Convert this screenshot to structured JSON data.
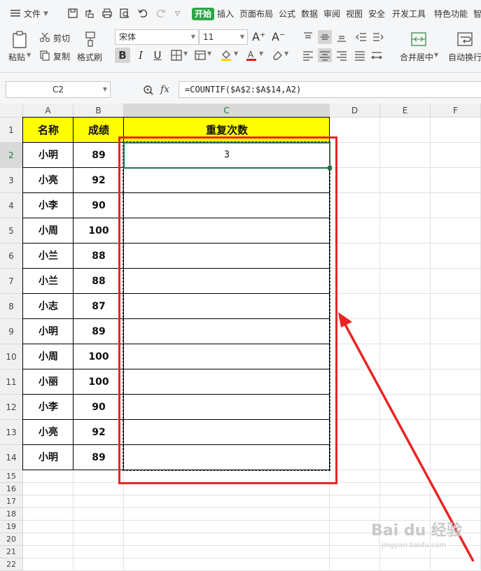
{
  "menubar": {
    "items": [
      "文件",
      "开始",
      "插入",
      "页面布局",
      "公式",
      "数据",
      "审阅",
      "视图",
      "安全",
      "开发工具",
      "特色功能",
      "智"
    ],
    "active_index": 1
  },
  "ribbon": {
    "paste_label": "粘贴",
    "cut_label": "剪切",
    "copy_label": "复制",
    "format_painter_label": "格式刷",
    "font_name": "宋体",
    "font_size": "11",
    "bold": "B",
    "italic": "I",
    "underline": "U",
    "merge_center_label": "合并居中",
    "auto_wrap_label": "自动换行",
    "font_grow": "A⁺",
    "font_shrink": "A⁻"
  },
  "formula_bar": {
    "name_box": "C2",
    "fx": "fx",
    "formula": "=COUNTIF($A$2:$A$14,A2)"
  },
  "grid": {
    "columns": [
      "A",
      "B",
      "C",
      "D",
      "E",
      "F"
    ],
    "selected_column": "C",
    "rows": [
      "1",
      "2",
      "3",
      "4",
      "5",
      "6",
      "7",
      "8",
      "9",
      "10",
      "11",
      "12",
      "13",
      "14",
      "15",
      "16",
      "17",
      "18",
      "19",
      "20",
      "21",
      "22"
    ],
    "selected_row": "2",
    "header": [
      "名称",
      "成绩",
      "重复次数"
    ],
    "data": [
      [
        "小明",
        "89",
        "3"
      ],
      [
        "小亮",
        "92",
        ""
      ],
      [
        "小李",
        "90",
        ""
      ],
      [
        "小周",
        "100",
        ""
      ],
      [
        "小兰",
        "88",
        ""
      ],
      [
        "小兰",
        "88",
        ""
      ],
      [
        "小志",
        "87",
        ""
      ],
      [
        "小明",
        "89",
        ""
      ],
      [
        "小周",
        "100",
        ""
      ],
      [
        "小丽",
        "100",
        ""
      ],
      [
        "小李",
        "90",
        ""
      ],
      [
        "小亮",
        "92",
        ""
      ],
      [
        "小明",
        "89",
        ""
      ]
    ]
  },
  "colors": {
    "header_fill": "#ffff00",
    "annotation": "#e82525",
    "active_accent": "#29a745"
  },
  "watermark": {
    "text": "Bai du 经验",
    "sub": "jingyan.baidu.com"
  }
}
